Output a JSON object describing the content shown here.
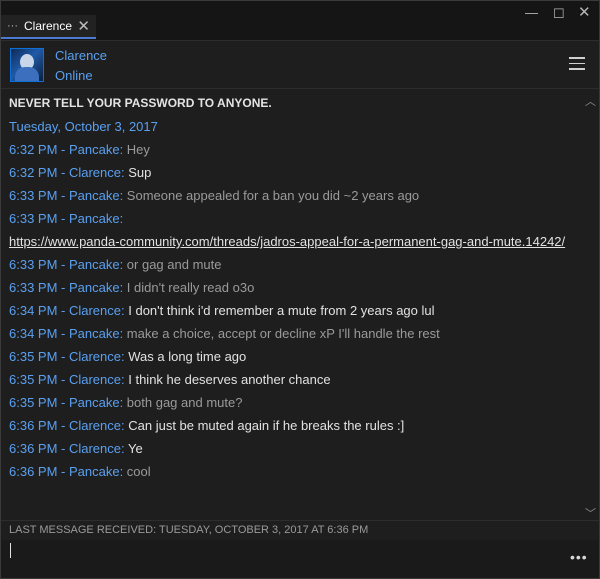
{
  "tab": {
    "dots": "···",
    "label": "Clarence",
    "close": "✕"
  },
  "window_controls": {
    "minimize": "—",
    "maximize": "☐",
    "close": "✕"
  },
  "contact": {
    "name": "Clarence",
    "status": "Online",
    "avatar_icon": "avatar-icon"
  },
  "warning": "NEVER TELL YOUR PASSWORD TO ANYONE.",
  "date": "Tuesday, October 3, 2017",
  "messages": [
    {
      "meta": "6:32 PM - Pancake",
      "sep": ": ",
      "text": "Hey",
      "author": "pancake"
    },
    {
      "meta": "6:32 PM - Clarence",
      "sep": ": ",
      "text": "Sup",
      "author": "clarence"
    },
    {
      "meta": "6:33 PM - Pancake",
      "sep": ": ",
      "text": "Someone appealed for a ban you did ~2 years ago",
      "author": "pancake"
    },
    {
      "meta": "6:33 PM - Pancake",
      "sep": ":",
      "text": "",
      "author": "pancake"
    },
    {
      "link": "https://www.panda-community.com/threads/jadros-appeal-for-a-permanent-gag-and-mute.14242/"
    },
    {
      "meta": "6:33 PM - Pancake",
      "sep": ": ",
      "text": "or gag and mute",
      "author": "pancake"
    },
    {
      "meta": "6:33 PM - Pancake",
      "sep": ": ",
      "text": "I didn't really read o3o",
      "author": "pancake"
    },
    {
      "meta": "6:34 PM - Clarence",
      "sep": ": ",
      "text": "I don't think i'd remember a mute from 2 years ago lul",
      "author": "clarence"
    },
    {
      "meta": "6:34 PM - Pancake",
      "sep": ": ",
      "text": "make a choice, accept or decline xP I'll handle the rest",
      "author": "pancake"
    },
    {
      "meta": "6:35 PM - Clarence",
      "sep": ": ",
      "text": "Was a long time ago",
      "author": "clarence"
    },
    {
      "meta": "6:35 PM - Clarence",
      "sep": ": ",
      "text": "I think he deserves another chance",
      "author": "clarence"
    },
    {
      "meta": "6:35 PM - Pancake",
      "sep": ": ",
      "text": "both gag and mute?",
      "author": "pancake"
    },
    {
      "meta": "6:36 PM - Clarence",
      "sep": ": ",
      "text": "Can just be muted again if he breaks the rules :]",
      "author": "clarence"
    },
    {
      "meta": "6:36 PM - Clarence",
      "sep": ": ",
      "text": "Ye",
      "author": "clarence"
    },
    {
      "meta": "6:36 PM - Pancake",
      "sep": ": ",
      "text": "cool",
      "author": "pancake"
    }
  ],
  "last_received": "LAST MESSAGE RECEIVED: TUESDAY, OCTOBER 3, 2017 AT 6:36 PM",
  "composer": {
    "value": "",
    "placeholder": "",
    "more": "•••"
  },
  "scroll": {
    "up": "︿",
    "down": "﹀"
  },
  "colors": {
    "accent": "#5aa0f0",
    "background": "#1e1e1e",
    "tab_underline": "#4b7bd0"
  }
}
